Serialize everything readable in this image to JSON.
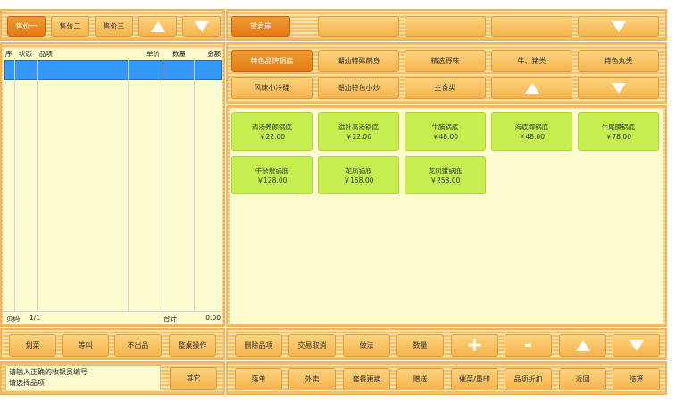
{
  "price_tabs": [
    {
      "label": "售价一",
      "active": true
    },
    {
      "label": "售价二",
      "active": false
    },
    {
      "label": "售价三",
      "active": false
    }
  ],
  "top_categories": [
    {
      "label": "望君岸",
      "active": true
    },
    {
      "label": "",
      "active": false
    },
    {
      "label": "",
      "active": false
    },
    {
      "label": "",
      "active": false
    }
  ],
  "order_table": {
    "headers": {
      "seq": "序",
      "status": "状态",
      "item": "品项",
      "price": "单价",
      "qty": "数量",
      "amount": "金额"
    },
    "page_label": "页码",
    "page_value": "1/1",
    "total_label": "合计",
    "total_value": "0.00"
  },
  "sub_categories": [
    {
      "label": "特色品牌锅底",
      "active": true
    },
    {
      "label": "潮汕特殊刺身",
      "active": false
    },
    {
      "label": "精选野味",
      "active": false
    },
    {
      "label": "牛、猪类",
      "active": false
    },
    {
      "label": "特色丸类",
      "active": false
    },
    {
      "label": "风味小冷碟",
      "active": false
    },
    {
      "label": "潮汕特色小炒",
      "active": false
    },
    {
      "label": "主食类",
      "active": false
    }
  ],
  "dishes": [
    {
      "name": "清汤养颜锅底",
      "price": "￥22.00"
    },
    {
      "name": "滋补高汤锅底",
      "price": "￥22.00"
    },
    {
      "name": "牛腩锅底",
      "price": "￥48.00"
    },
    {
      "name": "海底椰锅底",
      "price": "￥48.00"
    },
    {
      "name": "牛尾腰锅底",
      "price": "￥78.00"
    },
    {
      "name": "牛杂烩锅底",
      "price": "￥128.00"
    },
    {
      "name": "龙凤锅底",
      "price": "￥158.00"
    },
    {
      "name": "龙凤蟹锅底",
      "price": "￥258.00"
    }
  ],
  "left_actions": [
    "划菜",
    "等叫",
    "不出品",
    "整桌操作"
  ],
  "right_actions": [
    "删除品项",
    "交易取消",
    "做法",
    "数量"
  ],
  "status_messages": [
    "请输入正确的收银员编号",
    "请选择品项"
  ],
  "other_label": "其它",
  "bottom_actions": [
    "落单",
    "外卖",
    "套餐更换",
    "赠送",
    "催菜/重印",
    "品项折扣",
    "返回",
    "结算"
  ],
  "colors": {
    "active": "#e57a14",
    "button": "#f6b44f",
    "dish": "#c6ee4e",
    "panel": "#fffbd0",
    "selected_row": "#3399ff"
  }
}
